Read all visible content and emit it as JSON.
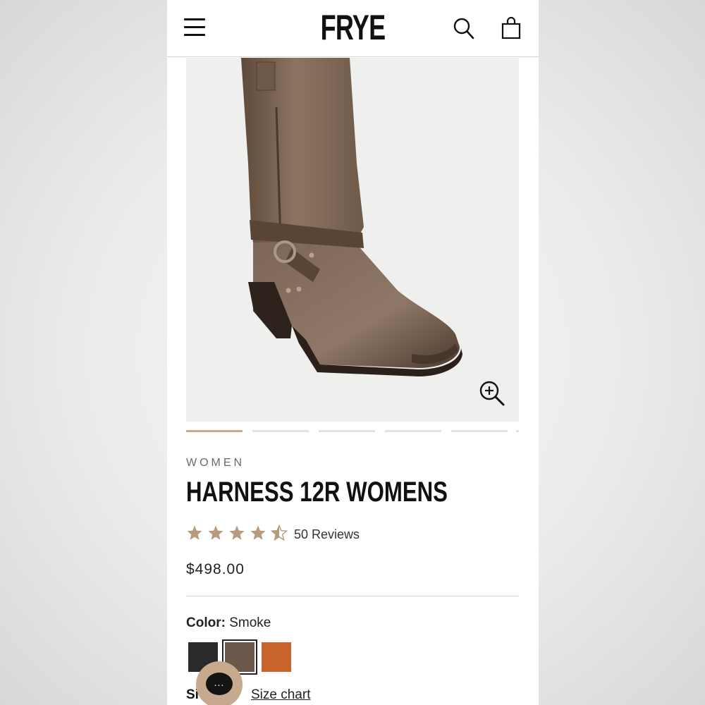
{
  "header": {
    "logo_text": "FRYE",
    "menu_icon": "hamburger-menu-icon",
    "search_icon": "search-icon",
    "bag_icon": "shopping-bag-icon"
  },
  "product": {
    "image_alt": "Brown leather harness boot",
    "zoom_icon": "zoom-in-icon",
    "carousel": {
      "count": 5,
      "active_index": 0
    },
    "category": "WOMEN",
    "title": "HARNESS 12R WOMENS",
    "rating": {
      "value": 4.5,
      "max": 5
    },
    "reviews_label": "50 Reviews",
    "price": "$498.00",
    "color_label": "Color:",
    "color_value": "Smoke",
    "swatches": [
      {
        "name": "Black",
        "hex": "#2a2a2a",
        "selected": false
      },
      {
        "name": "Smoke",
        "hex": "#6b584b",
        "selected": true
      },
      {
        "name": "Cognac",
        "hex": "#c9642d",
        "selected": false
      }
    ],
    "size_label": "Si",
    "size_chart_label": "Size chart"
  },
  "chat": {
    "icon": "chat-bubble-icon",
    "dots": "..."
  },
  "colors": {
    "accent": "#c9a98a",
    "star": "#b69b7d",
    "text": "#111111"
  }
}
